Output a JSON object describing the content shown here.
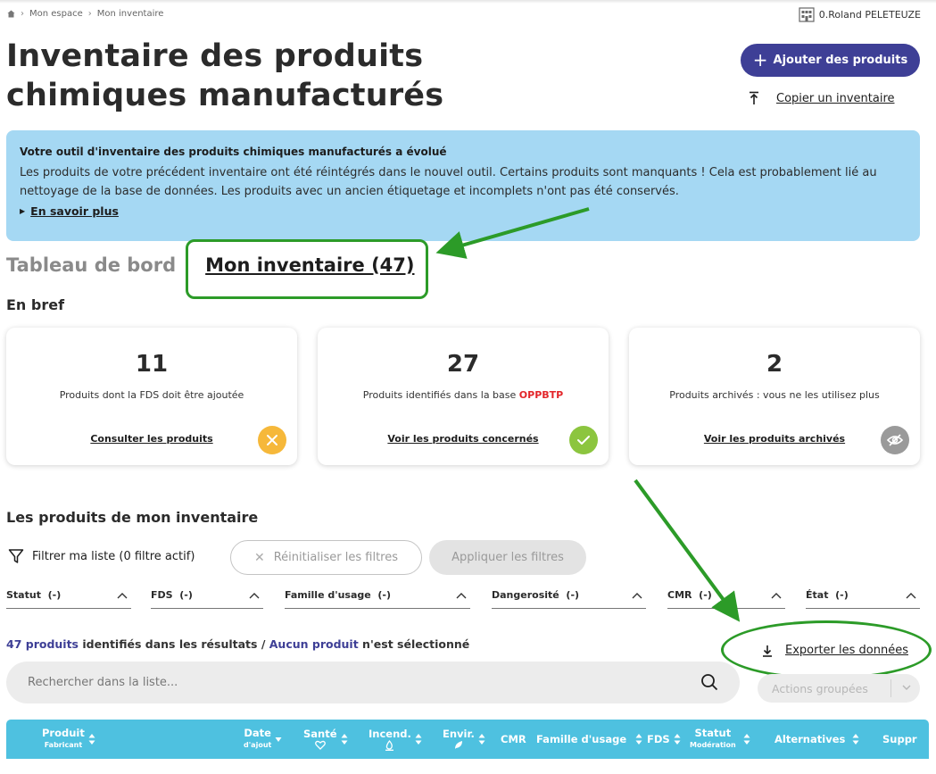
{
  "breadcrumb": {
    "items": [
      "Mon espace",
      "Mon inventaire"
    ]
  },
  "user": {
    "name": "0.Roland PELETEUZE"
  },
  "page": {
    "title": "Inventaire des produits chimiques manufacturés"
  },
  "actions": {
    "add_label": "Ajouter des produits",
    "copy_label": "Copier un inventaire"
  },
  "info": {
    "heading": "Votre outil d'inventaire des produits chimiques manufacturés a évolué",
    "body": "Les produits de votre précédent inventaire ont été réintégrés dans le nouvel outil. Certains produits sont manquants ! Cela est probablement lié au nettoyage de la base de données. Les produits avec un ancien étiquetage et incomplets n'ont pas été conservés.",
    "more": "En savoir plus"
  },
  "tabs": {
    "dashboard": "Tableau de bord",
    "inventory": "Mon inventaire (47)"
  },
  "summary": {
    "title": "En bref",
    "cards": [
      {
        "value": "11",
        "desc": "Produits dont la FDS doit être ajoutée",
        "desc_highlight": "",
        "link": "Consulter les produits",
        "icon": "close-icon",
        "color": "#f6b83a"
      },
      {
        "value": "27",
        "desc": "Produits identifiés dans la base ",
        "desc_highlight": "OPPBTP",
        "link": "Voir les produits concernés",
        "icon": "check-icon",
        "color": "#8cc53f"
      },
      {
        "value": "2",
        "desc": "Produits archivés : vous ne les utilisez plus",
        "desc_highlight": "",
        "link": "Voir les produits archivés",
        "icon": "eye-off-icon",
        "color": "#9a9a9a"
      }
    ]
  },
  "products": {
    "title": "Les produits de mon inventaire",
    "filter_label": "Filtrer ma liste (0 filtre actif)",
    "reset_label": "Réinitialiser les filtres",
    "apply_label": "Appliquer les filtres",
    "filters": [
      {
        "label": "Statut",
        "value": "(-)"
      },
      {
        "label": "FDS",
        "value": "(-)"
      },
      {
        "label": "Famille d'usage",
        "value": "(-)"
      },
      {
        "label": "Dangerosité",
        "value": "(-)"
      },
      {
        "label": "CMR",
        "value": "(-)"
      },
      {
        "label": "État",
        "value": "(-)"
      }
    ],
    "results_count": "47 produits",
    "results_text": " identifiés dans les résultats / ",
    "selection_count": "Aucun produit",
    "selection_text": " n'est sélectionné",
    "export_label": "Exporter les données",
    "search_placeholder": "Rechercher dans la liste...",
    "group_actions": "Actions groupées"
  },
  "table": {
    "columns": [
      {
        "label": "Produit",
        "sub": "Fabricant"
      },
      {
        "label": "Date",
        "sub": "d'ajout"
      },
      {
        "label": "Santé",
        "sub": ""
      },
      {
        "label": "Incend.",
        "sub": ""
      },
      {
        "label": "Envir.",
        "sub": ""
      },
      {
        "label": "CMR",
        "sub": ""
      },
      {
        "label": "Famille d'usage",
        "sub": ""
      },
      {
        "label": "FDS",
        "sub": ""
      },
      {
        "label": "Statut",
        "sub": "Modération"
      },
      {
        "label": "Alternatives",
        "sub": ""
      },
      {
        "label": "Suppr",
        "sub": ""
      }
    ]
  },
  "colors": {
    "primary": "#3e3f96",
    "info_bg": "#a5d8f3",
    "table_header": "#4ec1e0",
    "annotation": "#2c9b28"
  }
}
